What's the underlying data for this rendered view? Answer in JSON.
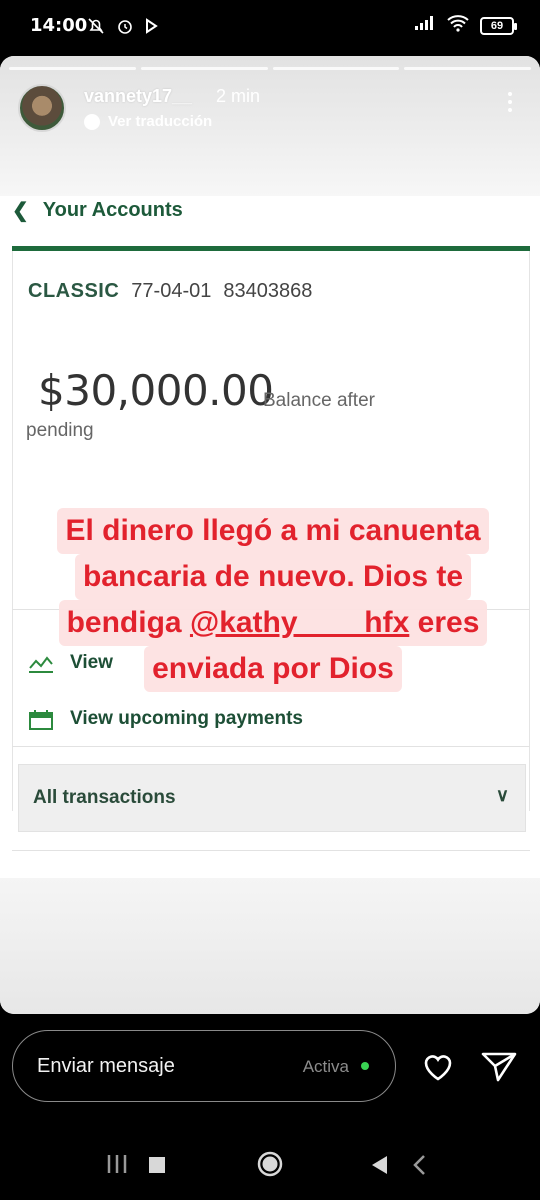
{
  "status_bar": {
    "time": "14:00",
    "battery": "69",
    "icons": [
      "bell-off-icon",
      "alarm-icon",
      "play-icon",
      "signal-icon",
      "wifi-icon",
      "battery-icon"
    ]
  },
  "story": {
    "progress_segments": 4,
    "username": "vannety17__",
    "time_ago": "2 min",
    "translate_label": "Ver traducción"
  },
  "bank": {
    "back_label": "Your Accounts",
    "account_type": "CLASSIC",
    "sort_code": "77-04-01",
    "account_number": "83403868",
    "balance": "$30,000.00",
    "balance_label_line1": "Balance after",
    "balance_label_line2": "pending",
    "link_view": "View",
    "link_upcoming": "View upcoming payments",
    "transactions_label": "All transactions"
  },
  "sticker": {
    "line1": "El dinero llegó a mi canuenta",
    "line2": "bancaria de nuevo.  Dios te",
    "line3_prefix": "bendiga ",
    "line3_mention": "@kathy____hfx",
    "line3_suffix": " eres",
    "line4": "enviada por Dios",
    "color": "#e2222d",
    "background": "#fde2e2"
  },
  "reply": {
    "placeholder": "Enviar mensaje",
    "status": "Activa",
    "status_color": "#39d353"
  },
  "colors": {
    "bank_green": "#1e6b3c"
  }
}
